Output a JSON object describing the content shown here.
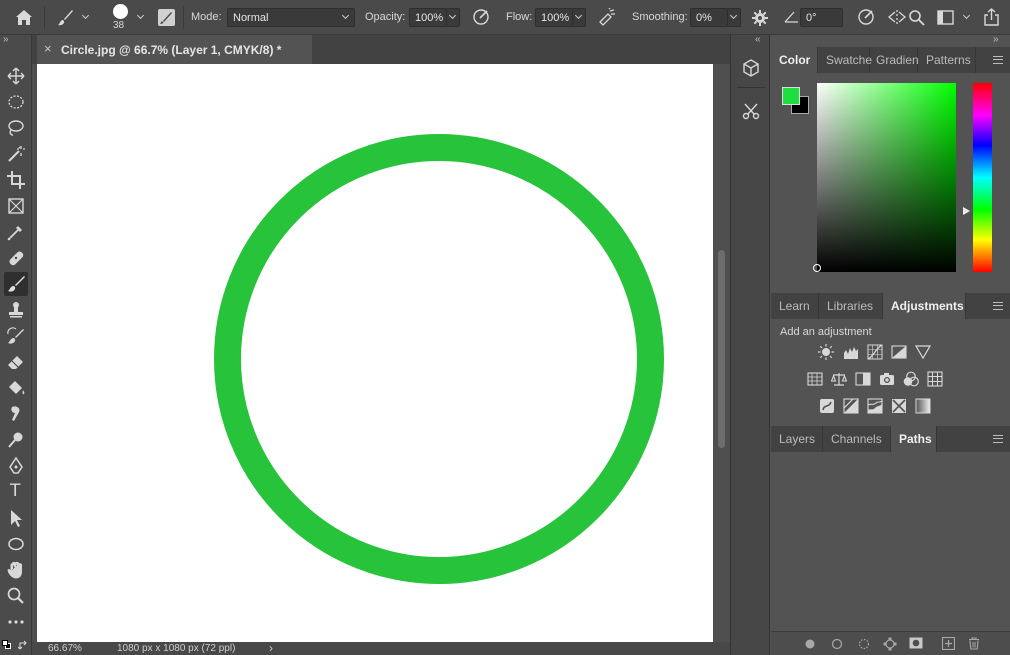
{
  "options_bar": {
    "brush_size": "38",
    "mode_label": "Mode:",
    "mode_value": "Normal",
    "opacity_label": "Opacity:",
    "opacity_value": "100%",
    "flow_label": "Flow:",
    "flow_value": "100%",
    "smoothing_label": "Smoothing:",
    "smoothing_value": "0%",
    "angle_value": "0°"
  },
  "document": {
    "tab_title": "Circle.jpg @ 66.7% (Layer 1, CMYK/8) *",
    "close_glyph": "×"
  },
  "canvas": {
    "ring_color": "#27c33a",
    "background": "#ffffff"
  },
  "status": {
    "zoom": "66.67%",
    "doc_info": "1080 px x 1080 px (72 ppl)",
    "arrow": "›"
  },
  "color_panel": {
    "tabs": [
      "Color",
      "Swatche",
      "Gradien",
      "Patterns"
    ],
    "foreground": "#1de040",
    "background": "#000000",
    "hue_color": "#00ff00"
  },
  "adjustments_panel": {
    "tabs": [
      "Learn",
      "Libraries",
      "Adjustments"
    ],
    "heading": "Add an adjustment"
  },
  "paths_panel": {
    "tabs": [
      "Layers",
      "Channels",
      "Paths"
    ]
  },
  "collapse_glyphs": {
    "left": "»",
    "right": "«"
  },
  "toolbar": {
    "type_tool": "T"
  }
}
